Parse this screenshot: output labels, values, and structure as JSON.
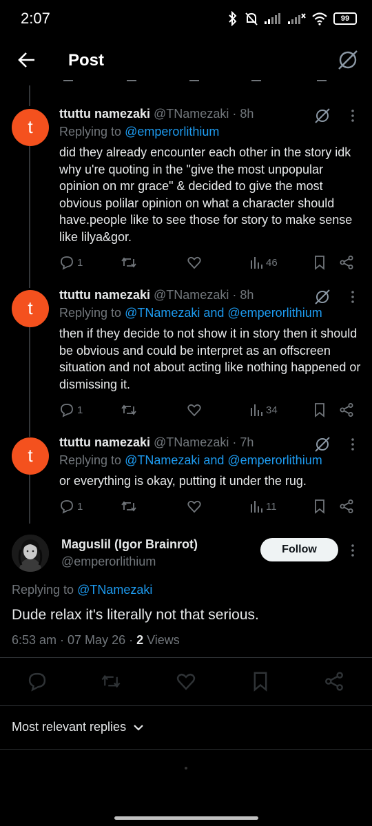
{
  "status_bar": {
    "time": "2:07",
    "battery": "99"
  },
  "header": {
    "title": "Post"
  },
  "replies": [
    {
      "name": "ttuttu namezaki",
      "handle": "@TNamezaki",
      "time": "· 8h",
      "avatar_letter": "t",
      "replying_prefix": "Replying to ",
      "replying_to": "@emperorlithium",
      "text": "did they already encounter each other in the story idk why u're quoting in the \"give the most unpopular opinion on mr grace\" & decided to give the most obvious polilar opinion on what a character should have.people like to see those for story to make sense  like lilya&gor.",
      "replies_count": "1",
      "views": "46"
    },
    {
      "name": "ttuttu namezaki",
      "handle": "@TNamezaki",
      "time": "· 8h",
      "avatar_letter": "t",
      "replying_prefix": "Replying to ",
      "replying_to": "@TNamezaki and @emperorlithium",
      "text": "then if they decide to not show it in story then it should be obvious and could be interpret as an offscreen situation and not about acting like nothing happened or dismissing it.",
      "replies_count": "1",
      "views": "34"
    },
    {
      "name": "ttuttu namezaki",
      "handle": "@TNamezaki",
      "time": "· 7h",
      "avatar_letter": "t",
      "replying_prefix": "Replying to ",
      "replying_to": "@TNamezaki and @emperorlithium",
      "text": "or everything is okay, putting it under the rug.",
      "replies_count": "1",
      "views": "11"
    }
  ],
  "main_post": {
    "name": "Maguslil (Igor Brainrot)",
    "handle": "@emperorlithium",
    "follow_label": "Follow",
    "replying_prefix": "Replying to ",
    "replying_to": "@TNamezaki",
    "text": "Dude relax it's literally not that serious.",
    "timestamp": "6:53 am · 07 May 26 · ",
    "views_count": "2",
    "views_label": " Views"
  },
  "sort": {
    "label": "Most relevant replies"
  },
  "colors": {
    "accent": "#1d9bf0",
    "avatar_orange": "#f4511e",
    "muted": "#71767b"
  }
}
